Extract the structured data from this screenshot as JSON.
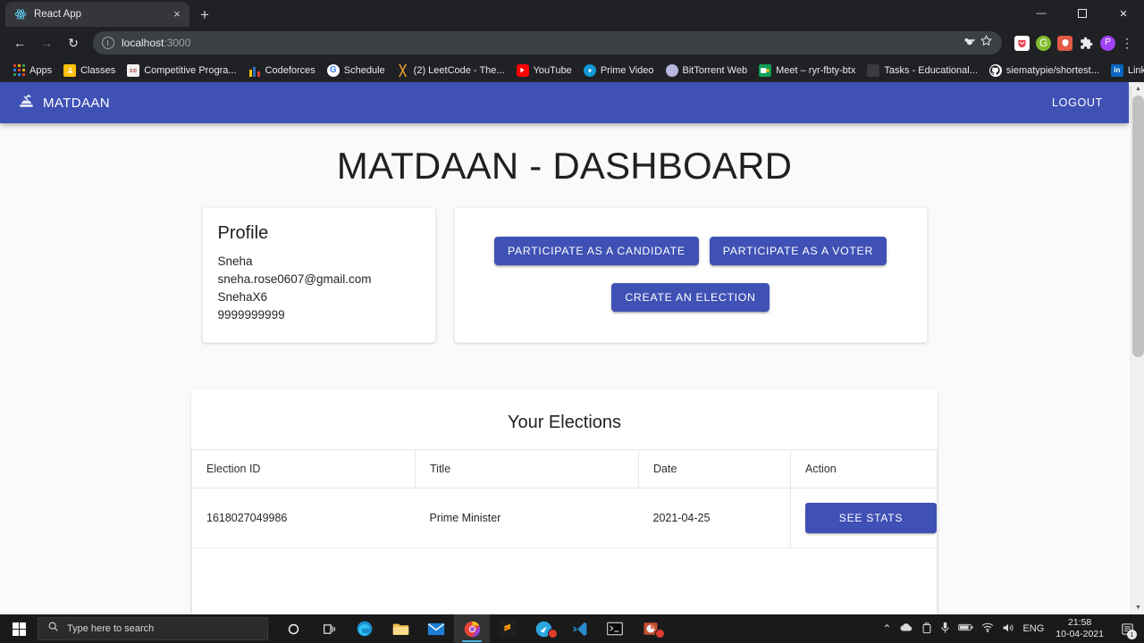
{
  "browser": {
    "tab": {
      "title": "React App",
      "favicon": "react-icon",
      "close_label": "×"
    },
    "new_tab_label": "+",
    "window_controls": {
      "minimize": "—",
      "maximize": "❐",
      "close": "✕"
    },
    "nav": {
      "back": "←",
      "forward": "→",
      "reload": "↻"
    },
    "omnibox": {
      "url_host": "localhost",
      "url_rest": ":3000",
      "key_icon": "key-icon",
      "star_icon": "star-icon"
    },
    "extensions": [
      "pocket-extension-icon",
      "grammarly-extension-icon",
      "adblock-extension-icon",
      "puzzle-extensions-icon",
      "profile-avatar-p"
    ],
    "menu_label": "⋮",
    "bookmarks": [
      {
        "label": "Apps",
        "icon": "apps-grid-icon"
      },
      {
        "label": "Classes",
        "icon": "classroom-icon"
      },
      {
        "label": "Competitive Progra...",
        "icon": "cc-icon"
      },
      {
        "label": "Codeforces",
        "icon": "codeforces-icon"
      },
      {
        "label": "Schedule",
        "icon": "google-icon"
      },
      {
        "label": "(2) LeetCode - The...",
        "icon": "leetcode-icon"
      },
      {
        "label": "YouTube",
        "icon": "youtube-icon"
      },
      {
        "label": "Prime Video",
        "icon": "prime-video-icon"
      },
      {
        "label": "BitTorrent Web",
        "icon": "bittorrent-icon"
      },
      {
        "label": "Meet – ryr-fbty-btx",
        "icon": "meet-icon"
      },
      {
        "label": "Tasks - Educational...",
        "icon": "tasks-icon"
      },
      {
        "label": "siematypie/shortest...",
        "icon": "github-icon"
      },
      {
        "label": "LinkedIn",
        "icon": "linkedin-icon"
      }
    ],
    "bookmarks_overflow_label": "»"
  },
  "theme": {
    "primary": "#3f51b5",
    "page_bg": "#fafafa",
    "card_bg": "#ffffff",
    "text": "#202020"
  },
  "appbar": {
    "brand": "MATDAAN",
    "brand_icon": "how-to-vote-icon",
    "logout_label": "LOGOUT"
  },
  "page": {
    "title": "MATDAAN - DASHBOARD"
  },
  "profile": {
    "heading": "Profile",
    "name": "Sneha",
    "email": "sneha.rose0607@gmail.com",
    "username": "SnehaX6",
    "phone": "9999999999"
  },
  "actions": {
    "participate_candidate": "PARTICIPATE AS A CANDIDATE",
    "participate_voter": "PARTICIPATE AS A VOTER",
    "create_election": "CREATE AN ELECTION"
  },
  "elections": {
    "heading": "Your Elections",
    "columns": [
      "Election ID",
      "Title",
      "Date",
      "Action"
    ],
    "rows": [
      {
        "election_id": "1618027049986",
        "title": "Prime Minister",
        "date": "2021-04-25",
        "action_label": "SEE STATS"
      }
    ]
  },
  "taskbar": {
    "search_placeholder": "Type here to search",
    "apps": [
      "cortana-icon",
      "task-view-icon",
      "microsoft-edge-icon",
      "file-explorer-icon",
      "mail-icon",
      "chrome-icon",
      "sublime-text-icon",
      "chrome-alt-icon",
      "vs-code-icon",
      "command-prompt-icon",
      "powerpoint-icon"
    ],
    "tray": {
      "chevron": "⌃",
      "icons": [
        "onedrive-icon",
        "safely-remove-icon",
        "microphone-icon",
        "battery-icon",
        "wifi-icon",
        "volume-icon"
      ],
      "language": "ENG",
      "time": "21:58",
      "date": "10-04-2021",
      "notification_count": "1"
    }
  }
}
